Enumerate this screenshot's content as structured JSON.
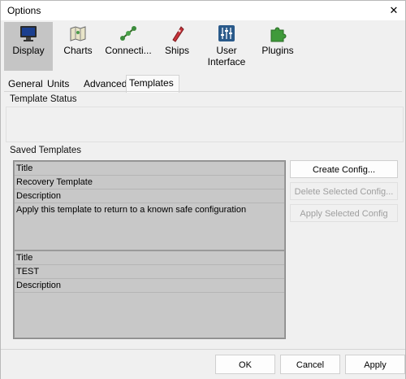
{
  "window": {
    "title": "Options",
    "close_glyph": "✕"
  },
  "toolbar": {
    "items": [
      {
        "label": "Display",
        "icon": "monitor-icon",
        "selected": true
      },
      {
        "label": "Charts",
        "icon": "map-icon"
      },
      {
        "label": "Connecti...",
        "icon": "connections-icon"
      },
      {
        "label": "Ships",
        "icon": "ship-icon"
      },
      {
        "label": "User\nInterface",
        "label_line1": "User",
        "label_line2": "Interface",
        "icon": "sliders-icon"
      },
      {
        "label": "Plugins",
        "icon": "puzzle-icon"
      }
    ]
  },
  "tabs": [
    {
      "label": "General"
    },
    {
      "label": "Units"
    },
    {
      "label": "Advanced"
    },
    {
      "label": "Templates",
      "active": true
    }
  ],
  "template_status": {
    "label": "Template Status"
  },
  "saved_templates": {
    "label": "Saved Templates",
    "items": [
      {
        "title_label": "Title",
        "title_value": "Recovery Template",
        "description_label": "Description",
        "description_value": "Apply this template to return to a known safe configuration"
      },
      {
        "title_label": "Title",
        "title_value": "TEST",
        "description_label": "Description",
        "description_value": ""
      }
    ]
  },
  "actions": {
    "create": "Create Config...",
    "delete": "Delete Selected Config...",
    "apply_selected": "Apply Selected Config"
  },
  "footer": {
    "ok": "OK",
    "cancel": "Cancel",
    "apply": "Apply"
  },
  "colors": {
    "selected_tool_bg": "#c5c5c5",
    "list_bg": "#c8c8c8",
    "disabled_text": "#9e9e9e"
  }
}
